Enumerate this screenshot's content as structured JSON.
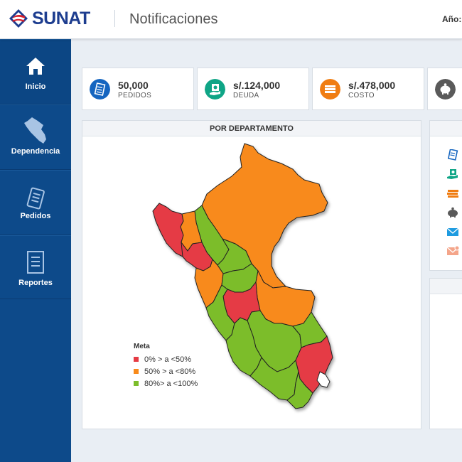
{
  "header": {
    "brand": "SUNAT",
    "title": "Notificaciones",
    "year_label": "Año:"
  },
  "sidebar": {
    "items": [
      {
        "label": "Inicio",
        "icon": "home-icon"
      },
      {
        "label": "Dependencia",
        "icon": "peru-map-icon"
      },
      {
        "label": "Pedidos",
        "icon": "document-icon"
      },
      {
        "label": "Reportes",
        "icon": "report-icon"
      }
    ]
  },
  "stats": [
    {
      "value": "50,000",
      "label": "PEDIDOS",
      "color": "#1565c0",
      "icon": "document-list-icon"
    },
    {
      "value": "s/.124,000",
      "label": "DEUDA",
      "color": "#0fa586",
      "icon": "money-hand-icon"
    },
    {
      "value": "s/.478,000",
      "label": "COSTO",
      "color": "#f07d12",
      "icon": "money-stack-icon"
    },
    {
      "value": "",
      "label": "",
      "color": "#5a5a5a",
      "icon": "piggy-bank-icon"
    }
  ],
  "map_panel": {
    "title": "POR DEPARTAMENTO",
    "legend_title": "Meta",
    "legend": [
      {
        "label": "0% > a <50%",
        "color": "#e53b44"
      },
      {
        "label": "50% > a <80%",
        "color": "#f88a1a"
      },
      {
        "label": "80%> a <100%",
        "color": "#7cbd2b"
      }
    ]
  },
  "right_panel": {
    "icons": [
      {
        "icon": "document-list-icon",
        "color": "#1565c0"
      },
      {
        "icon": "money-hand-icon",
        "color": "#0fa586"
      },
      {
        "icon": "money-stack-icon",
        "color": "#f07d12"
      },
      {
        "icon": "piggy-bank-icon",
        "color": "#5a5a5a"
      },
      {
        "icon": "envelope-icon",
        "color": "#1e9be0"
      },
      {
        "icon": "envelope-alert-icon",
        "color": "#f4a58a"
      }
    ]
  }
}
